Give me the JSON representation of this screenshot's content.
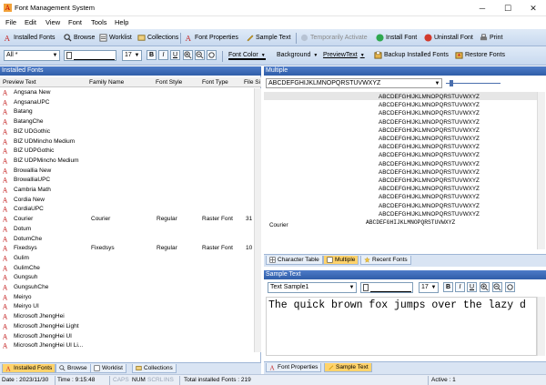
{
  "window": {
    "title": "Font Management System",
    "minimize": "─",
    "maximize": "☐",
    "close": "✕"
  },
  "menu": [
    "File",
    "Edit",
    "View",
    "Font",
    "Tools",
    "Help"
  ],
  "toolbar1": {
    "installed_fonts": "Installed Fonts",
    "browse": "Browse",
    "worklist": "Worklist",
    "collections": "Collections",
    "font_properties": "Font Properties",
    "sample_text": "Sample Text",
    "temporarily_activate": "Temporarily Activate",
    "install_font": "Install Font",
    "uninstall_font": "Uninstall Font",
    "print": "Print"
  },
  "toolbar2": {
    "filter_value": "All *",
    "font_size": "17",
    "bold": "B",
    "italic": "I",
    "underline": "U",
    "font_color": "Font Color",
    "background": "Background",
    "preview_text": "PreviewText",
    "backup": "Backup Installed Fonts",
    "restore": "Restore Fonts"
  },
  "installed_panel": {
    "title": "Installed Fonts",
    "columns": [
      "Preview Text",
      "Family Name",
      "Font Style",
      "Font Type",
      "File Si"
    ],
    "rows": [
      {
        "name": "Angsana New",
        "family": "",
        "style": "",
        "type": "",
        "size": ""
      },
      {
        "name": "AngsanaUPC",
        "family": "",
        "style": "",
        "type": "",
        "size": ""
      },
      {
        "name": "Batang",
        "family": "",
        "style": "",
        "type": "",
        "size": ""
      },
      {
        "name": "BatangChe",
        "family": "",
        "style": "",
        "type": "",
        "size": ""
      },
      {
        "name": "BIZ UDGothic",
        "family": "",
        "style": "",
        "type": "",
        "size": ""
      },
      {
        "name": "BIZ UDMincho Medium",
        "family": "",
        "style": "",
        "type": "",
        "size": ""
      },
      {
        "name": "BIZ UDPGothic",
        "family": "",
        "style": "",
        "type": "",
        "size": ""
      },
      {
        "name": "BIZ UDPMincho Medium",
        "family": "",
        "style": "",
        "type": "",
        "size": ""
      },
      {
        "name": "Browallia New",
        "family": "",
        "style": "",
        "type": "",
        "size": ""
      },
      {
        "name": "BrowalliaUPC",
        "family": "",
        "style": "",
        "type": "",
        "size": ""
      },
      {
        "name": "Cambria Math",
        "family": "",
        "style": "",
        "type": "",
        "size": ""
      },
      {
        "name": "Cordia New",
        "family": "",
        "style": "",
        "type": "",
        "size": ""
      },
      {
        "name": "CordiaUPC",
        "family": "",
        "style": "",
        "type": "",
        "size": ""
      },
      {
        "name": "Courier",
        "family": "Courier",
        "style": "Regular",
        "type": "Raster Font",
        "size": "31"
      },
      {
        "name": "Dotum",
        "family": "",
        "style": "",
        "type": "",
        "size": ""
      },
      {
        "name": "DotumChe",
        "family": "",
        "style": "",
        "type": "",
        "size": ""
      },
      {
        "name": "Fixedsys",
        "family": "Fixedsys",
        "style": "Regular",
        "type": "Raster Font",
        "size": "10"
      },
      {
        "name": "Gulim",
        "family": "",
        "style": "",
        "type": "",
        "size": ""
      },
      {
        "name": "GulimChe",
        "family": "",
        "style": "",
        "type": "",
        "size": ""
      },
      {
        "name": "Gungsuh",
        "family": "",
        "style": "",
        "type": "",
        "size": ""
      },
      {
        "name": "GungsuhChe",
        "family": "",
        "style": "",
        "type": "",
        "size": ""
      },
      {
        "name": "Meiryo",
        "family": "",
        "style": "",
        "type": "",
        "size": ""
      },
      {
        "name": "Meiryo UI",
        "family": "",
        "style": "",
        "type": "",
        "size": ""
      },
      {
        "name": "Microsoft JhengHei",
        "family": "",
        "style": "",
        "type": "",
        "size": ""
      },
      {
        "name": "Microsoft JhengHei Light",
        "family": "",
        "style": "",
        "type": "",
        "size": ""
      },
      {
        "name": "Microsoft JhengHei UI",
        "family": "",
        "style": "",
        "type": "",
        "size": ""
      },
      {
        "name": "Microsoft JhengHei UI Li...",
        "family": "",
        "style": "",
        "type": "",
        "size": ""
      }
    ],
    "tabs": [
      "Installed Fonts",
      "Browse",
      "Worklist",
      "Collections"
    ]
  },
  "multiple_panel": {
    "title": "Multiple",
    "preview_input": "ABCDEFGHIJKLMNOPQRSTUVWXYZ",
    "sample_rows": [
      "ABCDEFGHIJKLMNOPQRSTUVWXYZ",
      "ABCDEFGHIJKLMNOPQRSTUVWXYZ",
      "ABCDEFGHIJKLMNOPQRSTUVWXYZ",
      "ABCDEFGHIJKLMNOPQRSTUVWXYZ",
      "ABCDEFGHIJKLMNOPQRSTUVWXYZ",
      "ABCDEFGHIJKLMNOPQRSTUVWXYZ",
      "ABCDEFGHIJKLMNOPQRSTUVWXYZ",
      "ABCDEFGHIJKLMNOPQRSTUVWXYZ",
      "ABCDEFGHIJKLMNOPQRSTUVWXYZ",
      "ABCDEFGHIJKLMNOPQRSTUVWXYZ",
      "ABCDEFGHIJKLMNOPQRSTUVWXYZ",
      "ABCDEFGHIJKLMNOPQRSTUVWXYZ",
      "ABCDEFGHIJKLMNOPQRSTUVWXYZ",
      "ABCDEFGHIJKLMNOPQRSTUVWXYZ",
      "ABCDEFGHIJKLMNOPQRSTUVWXYZ",
      "ABCDEFGHIJKLMNOPQRSTUVWXYZ"
    ],
    "courier_label": "Courier",
    "tabs": [
      "Character Table",
      "Multiple",
      "Recent Fonts"
    ]
  },
  "sample_panel": {
    "title": "Sample Text",
    "sample_select": "Text Sample1",
    "font_size": "17",
    "text": "The quick brown fox jumps over the lazy d",
    "tabs": [
      "Font Properties",
      "Sample Text"
    ]
  },
  "status": {
    "date": "Date : 2023/11/30",
    "time": "Time : 9:15:48",
    "caps": "CAPS",
    "num": "NUM",
    "scrl": "SCRL",
    "ins": "INS",
    "total": "Total installed Fonts : 219",
    "active": "Active : 1"
  },
  "colors": {
    "accent": "#2f5ea8",
    "tab_active": "#ffd36b",
    "font_icon": "#c62828"
  }
}
